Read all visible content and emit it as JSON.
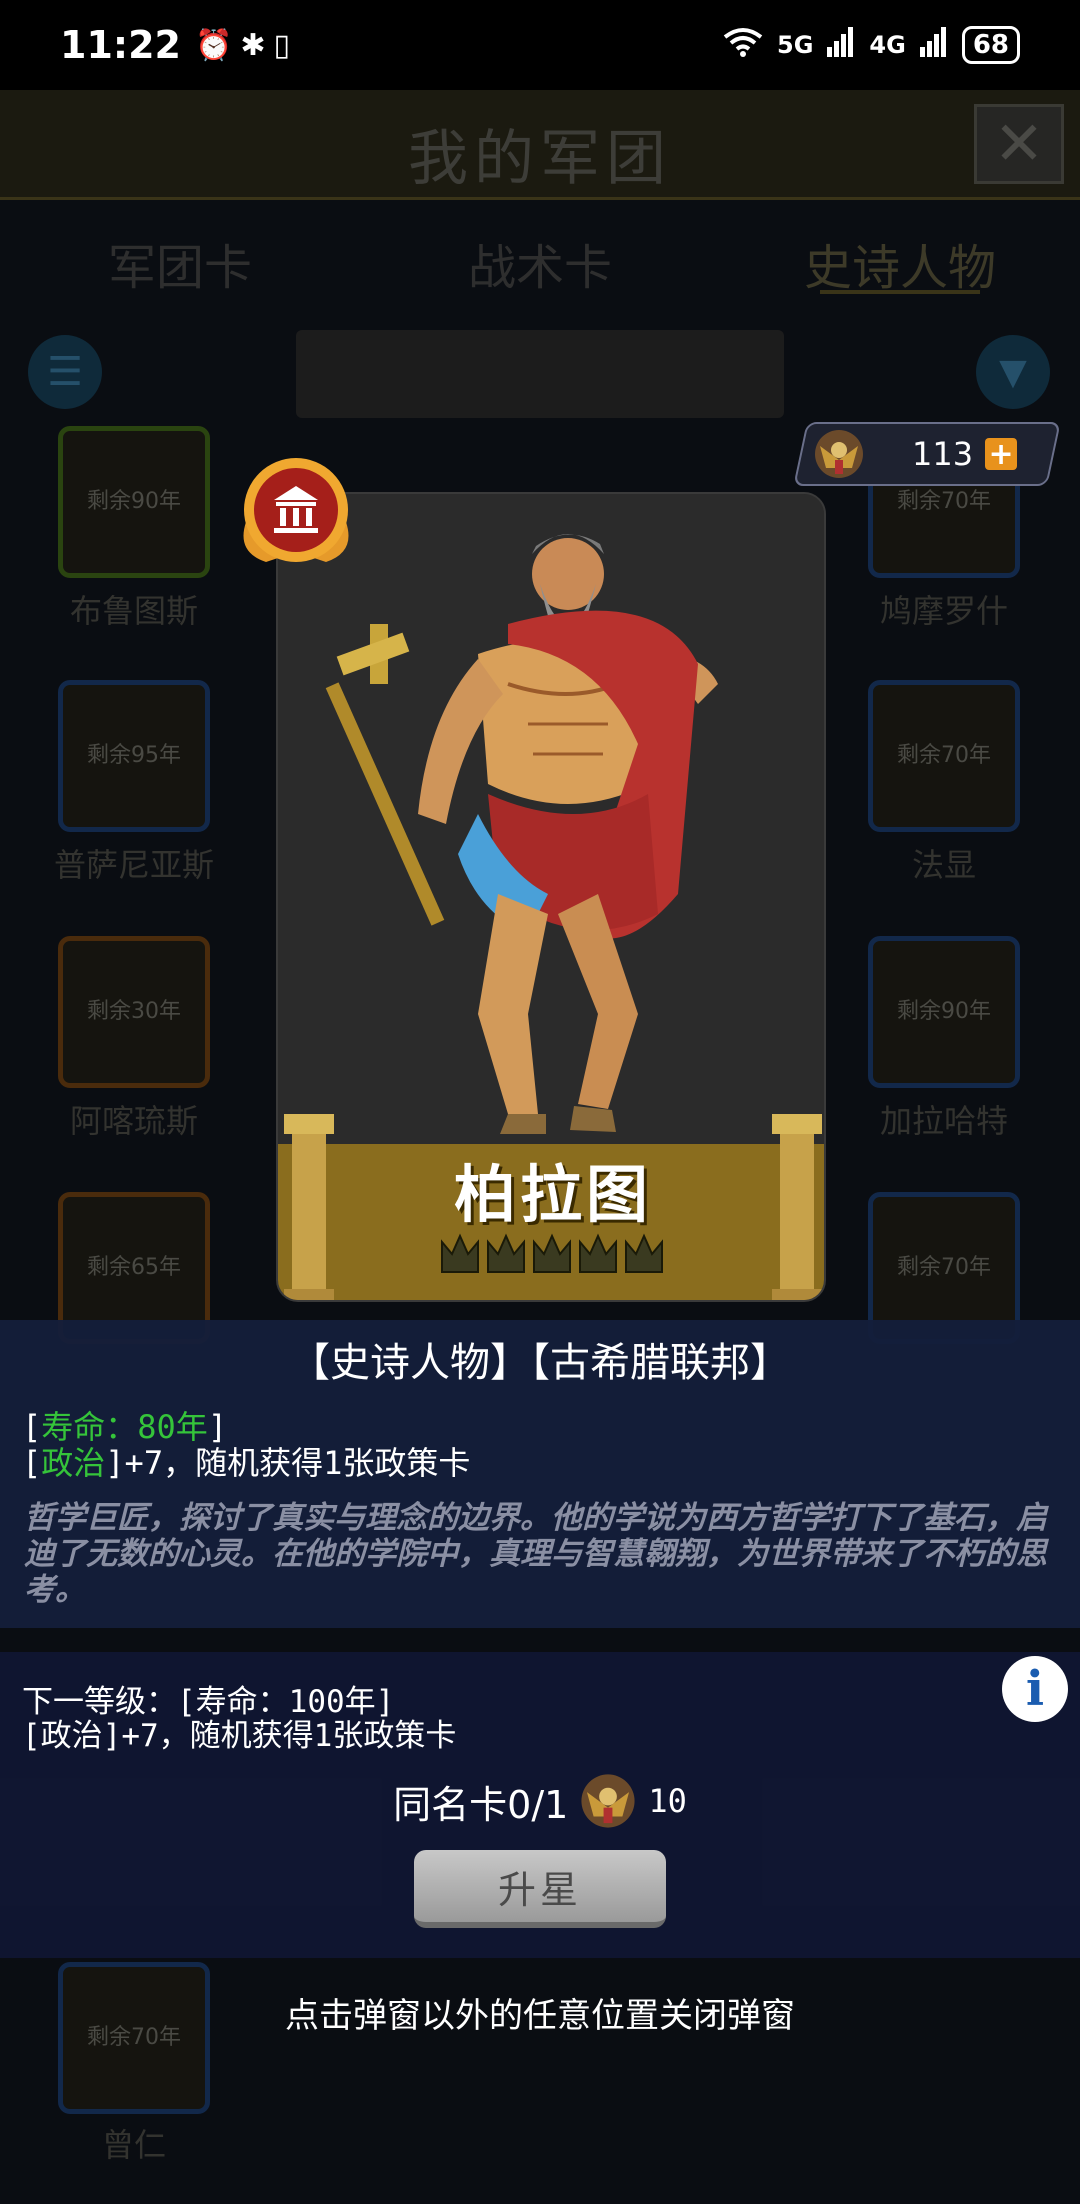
{
  "status_bar": {
    "time": "11:22",
    "network_5g": "5G",
    "network_4g": "4G",
    "battery": "68"
  },
  "background": {
    "title": "我的军团",
    "tabs": [
      "军团卡",
      "战术卡",
      "史诗人物"
    ],
    "cards": [
      {
        "badge": "剩余90年",
        "name": "布鲁图斯"
      },
      {
        "badge": "剩余70年",
        "name": "鸠摩罗什"
      },
      {
        "badge": "剩余95年",
        "name": "普萨尼亚斯"
      },
      {
        "badge": "剩余70年",
        "name": "法显"
      },
      {
        "badge": "剩余30年",
        "name": "阿喀琉斯"
      },
      {
        "badge": "剩余90年",
        "name": "加拉哈特"
      },
      {
        "badge": "剩余65年",
        "name": ""
      },
      {
        "badge": "剩余70年",
        "name": ""
      },
      {
        "badge": "剩余70年",
        "name": "曾仁"
      }
    ]
  },
  "currency": {
    "value": "113",
    "plus": "+"
  },
  "character": {
    "name": "柏拉图",
    "star_count": 5
  },
  "info": {
    "header": "【史诗人物】【古希腊联邦】",
    "lifespan_open": "[",
    "lifespan": "寿命：80年",
    "lifespan_close": "]",
    "politics_tag": "政治",
    "politics_effect": "+7，随机获得1张政策卡",
    "lore": "哲学巨匠，探讨了真实与理念的边界。他的学说为西方哲学打下了基石，启迪了无数的心灵。在他的学院中，真理与智慧翱翔，为世界带来了不朽的思考。"
  },
  "upgrade": {
    "next_level": "下一等级：[寿命：100年]",
    "next_effect": "[政治]+7，随机获得1张政策卡",
    "duplicate_label": "同名卡0/1",
    "cost": "10",
    "star_button": "升星"
  },
  "close_hint": "点击弹窗以外的任意位置关闭弹窗",
  "colors": {
    "accent_green": "#35c43a",
    "panel_blue": "#141e3a",
    "name_band": "#8a6d1e"
  }
}
